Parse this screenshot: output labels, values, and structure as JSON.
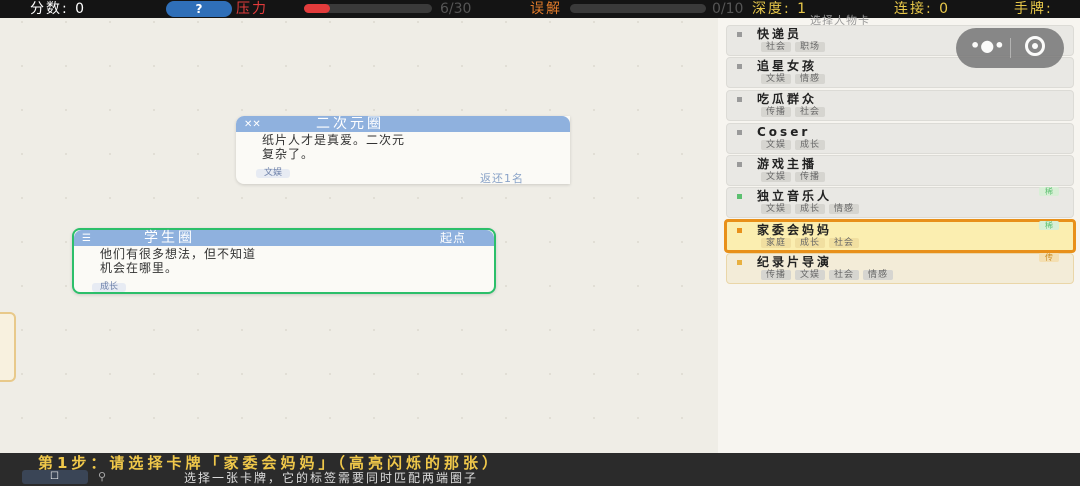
{
  "hud": {
    "score_label": "分数: 0",
    "help_label": "?",
    "pressure_label": "压力",
    "pressure_value": "6/30",
    "pressure_fraction": 0.2,
    "misread_label": "误解",
    "misread_value": "0/10",
    "depth_label": "深度: 1",
    "connect_label": "连接: 0",
    "hand_label": "手牌:"
  },
  "board": {
    "card1": {
      "title": "二次元圈",
      "emoji": "✕✕",
      "desc_line1": "纸片人才是真爱。二次元",
      "desc_line2": "复杂了。",
      "tag": "文娱",
      "return_text": "返还1名"
    },
    "card2": {
      "title": "学生圈",
      "emoji": "☰",
      "origin": "起点",
      "desc_line1": "他们有很多想法，但不知道",
      "desc_line2": "机会在哪里。",
      "tag": "成长"
    }
  },
  "panel": {
    "title": "选择人物卡",
    "items": [
      {
        "name": "快递员",
        "tags": [
          "社会",
          "职场"
        ]
      },
      {
        "name": "追星女孩",
        "tags": [
          "文娱",
          "情感"
        ]
      },
      {
        "name": "吃瓜群众",
        "tags": [
          "传播",
          "社会"
        ]
      },
      {
        "name": "Coser",
        "tags": [
          "文娱",
          "成长"
        ]
      },
      {
        "name": "游戏主播",
        "tags": [
          "文娱",
          "传播"
        ]
      },
      {
        "name": "独立音乐人",
        "tags": [
          "文娱",
          "成长",
          "情感"
        ],
        "badge": "稀"
      },
      {
        "name": "家委会妈妈",
        "tags": [
          "家庭",
          "成长",
          "社会"
        ],
        "badge": "稀"
      },
      {
        "name": "纪录片导演",
        "tags": [
          "传播",
          "文娱",
          "社会",
          "情感"
        ],
        "badge": "传"
      }
    ]
  },
  "capsule": {
    "more_icon": "•●•"
  },
  "bottom": {
    "step_text": "第1步：请选择卡牌「家委会妈妈」（高亮闪烁的那张）",
    "hint_text": "选择一张卡牌，它的标签需要同时匹配两端圈子"
  },
  "colors": {
    "selected_border": "#e8901a",
    "selected_bg": "#fbeeb0",
    "rare_green": "#5cc070",
    "student_green": "#2cbf6a",
    "circle_blue": "#8fb1de"
  }
}
